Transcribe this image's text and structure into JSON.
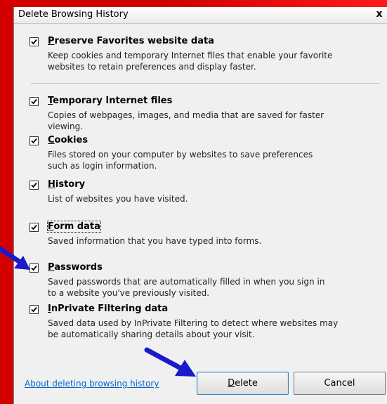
{
  "window": {
    "title": "Delete Browsing History",
    "close_glyph": "x"
  },
  "items": [
    {
      "accel": "P",
      "rest": "reserve Favorites website data",
      "checked": true,
      "lines": [
        "Keep cookies and temporary Internet files that enable your favorite",
        "websites to retain preferences and display faster."
      ]
    },
    {
      "accel": "T",
      "rest": "emporary Internet files",
      "checked": true,
      "lines": [
        "Copies of webpages, images, and media that are saved for faster",
        "viewing."
      ]
    },
    {
      "accel": "C",
      "rest": "ookies",
      "checked": true,
      "lines": [
        "Files stored on your computer by websites to save preferences",
        "such as login information."
      ]
    },
    {
      "accel": "H",
      "rest": "istory",
      "checked": true,
      "lines": [
        "List of websites you have visited."
      ]
    },
    {
      "accel": "F",
      "rest": "orm data",
      "checked": true,
      "lines": [
        "Saved information that you have typed into forms."
      ]
    },
    {
      "accel": "P",
      "rest": "asswords",
      "checked": true,
      "lines": [
        "Saved passwords that are automatically filled in when you sign in",
        "to a website you've previously visited."
      ]
    },
    {
      "accel": "I",
      "rest": "nPrivate Filtering data",
      "checked": true,
      "lines": [
        "Saved data used by InPrivate Filtering to detect where websites may",
        "be automatically sharing details about your visit."
      ]
    }
  ],
  "footer": {
    "help_link": "About deleting browsing history",
    "delete": {
      "accel": "D",
      "rest": "elete"
    },
    "cancel": "Cancel"
  },
  "colors": {
    "arrow": "#1a1acc",
    "background": "#cc0000",
    "link": "#0066cc"
  }
}
